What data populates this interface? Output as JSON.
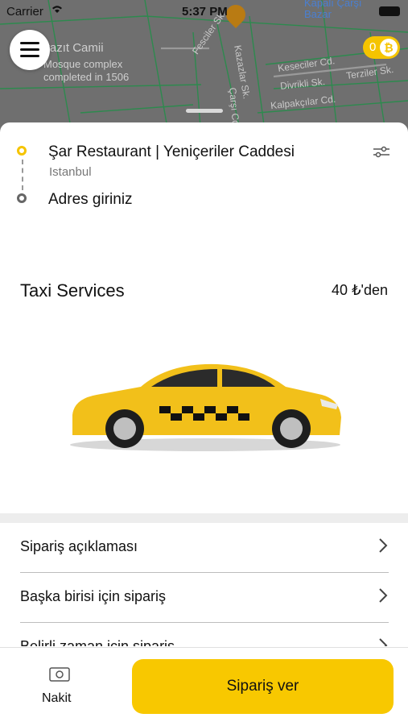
{
  "status_bar": {
    "carrier": "Carrier",
    "time": "5:37 PM"
  },
  "map": {
    "poi_beyazit_title": "Beyazıt Camii",
    "poi_beyazit_line1": "Mosque complex",
    "poi_beyazit_line2": "completed in 1506",
    "poi_bazar_title": "Kapalı Çarşı",
    "poi_bazar_sub": "Bazar",
    "streets": [
      "Fesciler Sk.",
      "Kazazlar Sk.",
      "Keseciler Cd.",
      "Divrikli Sk.",
      "Terziler Sk.",
      "Kalpakçılar Cd.",
      "Çarşı Cd."
    ]
  },
  "header": {
    "coin_count": "0",
    "coin_symbol": "₿"
  },
  "route": {
    "from_title": "Şar Restaurant | Yeniçeriler Caddesi",
    "from_subtitle": "Istanbul",
    "to_placeholder": "Adres giriniz"
  },
  "service": {
    "title": "Taxi Services",
    "price": "40 ₺'den"
  },
  "options": [
    {
      "label": "Sipariş açıklaması"
    },
    {
      "label": "Başka birisi için sipariş"
    },
    {
      "label": "Belirli zaman için sipariş"
    }
  ],
  "payment": {
    "label": "Nakit"
  },
  "order_button": {
    "label": "Sipariş ver"
  },
  "colors": {
    "accent": "#f8c800",
    "map_bg": "#6f6f6f"
  }
}
